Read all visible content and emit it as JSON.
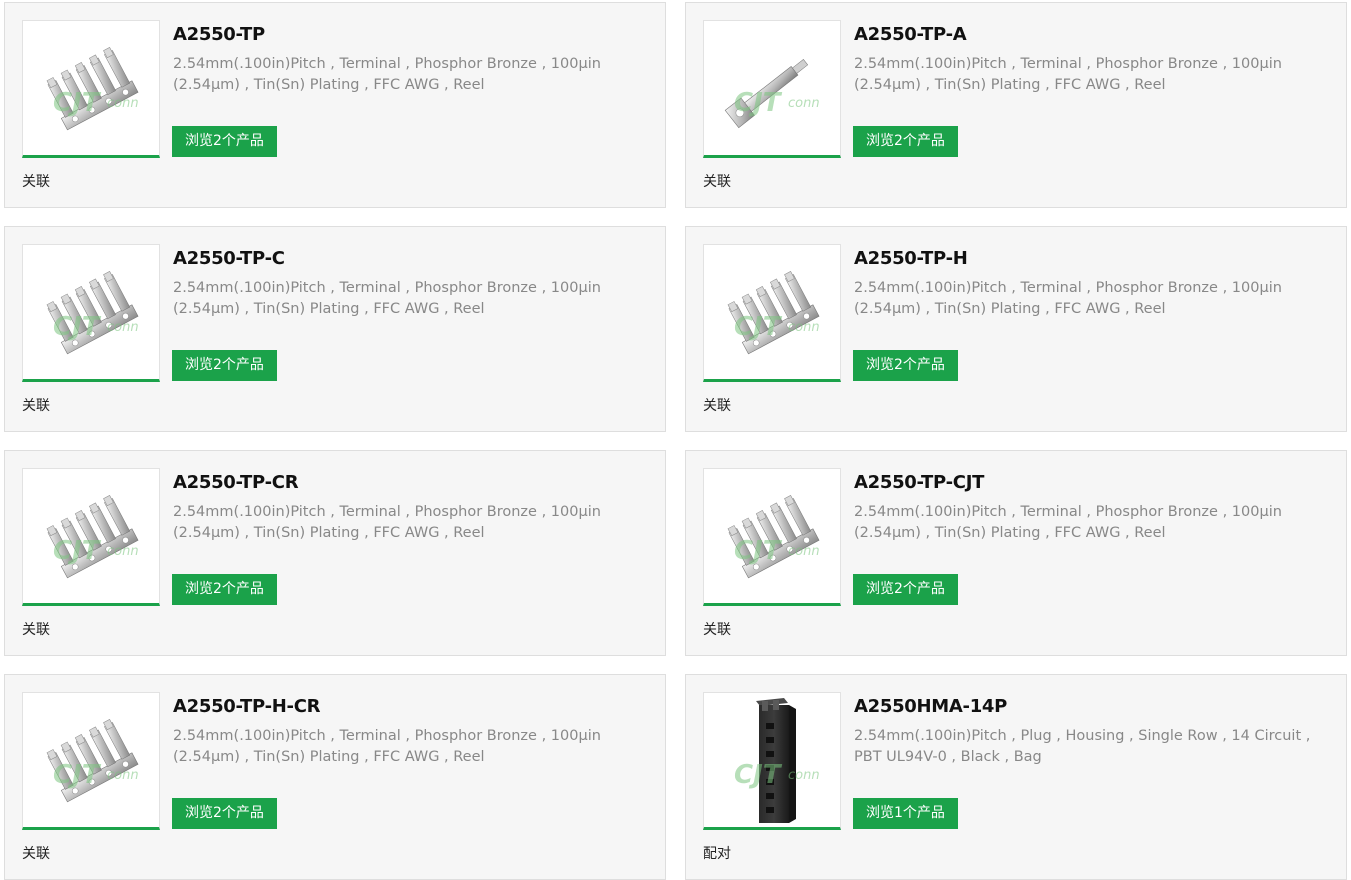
{
  "cards": [
    {
      "title": "A2550-TP",
      "desc": "2.54mm(.100in)Pitch , Terminal , Phosphor Bronze , 100µin (2.54µm) , Tin(Sn) Plating , FFC AWG , Reel",
      "button": "浏览2个产品",
      "relation": "关联",
      "image": "terminal-strip"
    },
    {
      "title": "A2550-TP-A",
      "desc": "2.54mm(.100in)Pitch , Terminal , Phosphor Bronze , 100µin (2.54µm) , Tin(Sn) Plating , FFC AWG , Reel",
      "button": "浏览2个产品",
      "relation": "关联",
      "image": "terminal-single"
    },
    {
      "title": "A2550-TP-C",
      "desc": "2.54mm(.100in)Pitch , Terminal , Phosphor Bronze , 100µin (2.54µm) , Tin(Sn) Plating , FFC AWG , Reel",
      "button": "浏览2个产品",
      "relation": "关联",
      "image": "terminal-strip"
    },
    {
      "title": "A2550-TP-H",
      "desc": "2.54mm(.100in)Pitch , Terminal , Phosphor Bronze , 100µin (2.54µm) , Tin(Sn) Plating , FFC AWG , Reel",
      "button": "浏览2个产品",
      "relation": "关联",
      "image": "terminal-strip"
    },
    {
      "title": "A2550-TP-CR",
      "desc": "2.54mm(.100in)Pitch , Terminal , Phosphor Bronze , 100µin (2.54µm) , Tin(Sn) Plating , FFC AWG , Reel",
      "button": "浏览2个产品",
      "relation": "关联",
      "image": "terminal-strip"
    },
    {
      "title": "A2550-TP-CJT",
      "desc": "2.54mm(.100in)Pitch , Terminal , Phosphor Bronze , 100µin (2.54µm) , Tin(Sn) Plating , FFC AWG , Reel",
      "button": "浏览2个产品",
      "relation": "关联",
      "image": "terminal-strip"
    },
    {
      "title": "A2550-TP-H-CR",
      "desc": "2.54mm(.100in)Pitch , Terminal , Phosphor Bronze , 100µin (2.54µm) , Tin(Sn) Plating , FFC AWG , Reel",
      "button": "浏览2个产品",
      "relation": "关联",
      "image": "terminal-strip"
    },
    {
      "title": "A2550HMA-14P",
      "desc": "2.54mm(.100in)Pitch , Plug , Housing , Single Row , 14 Circuit , PBT UL94V-0 , Black , Bag",
      "button": "浏览1个产品",
      "relation": "配对",
      "image": "housing-black"
    }
  ],
  "watermark": "CJTconn",
  "colors": {
    "accent": "#1ba24a",
    "card_bg": "#f6f6f6",
    "desc": "#888888"
  }
}
